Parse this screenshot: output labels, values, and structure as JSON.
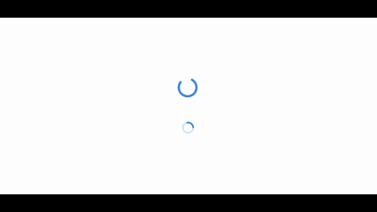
{
  "screen": {
    "state": "loading",
    "colors": {
      "letterbox": "#000000",
      "background": "#fdfdfd",
      "spinner_primary": "#3a86d8",
      "spinner_track": "#cfe2f6"
    },
    "indicators": [
      {
        "icon": "loading-spinner-icon"
      },
      {
        "icon": "loading-spinner-small-icon"
      }
    ]
  }
}
